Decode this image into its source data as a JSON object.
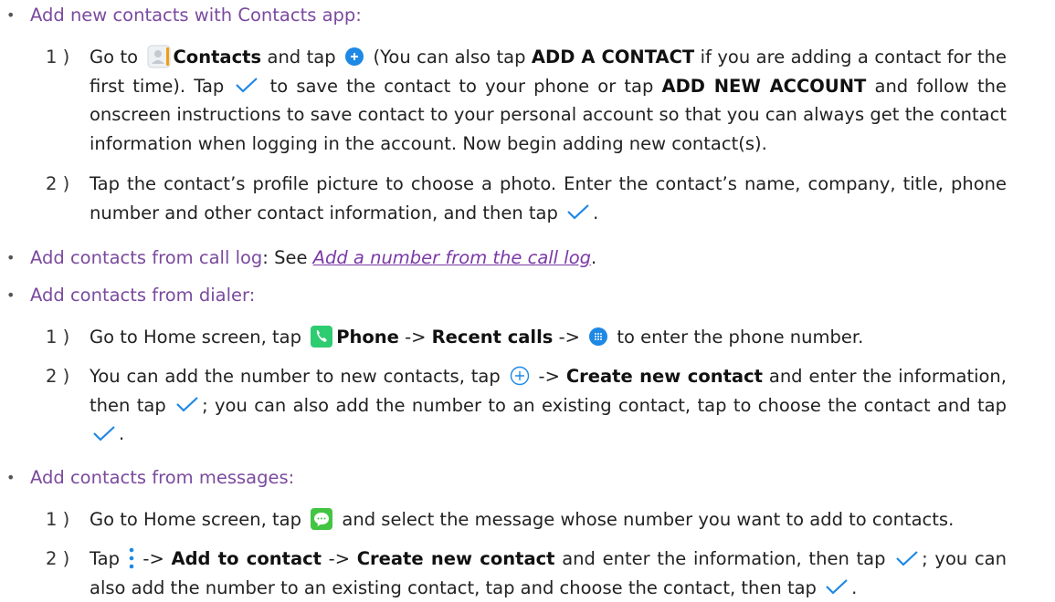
{
  "colors": {
    "heading": "#7b4a9e",
    "link": "#7b3aa6",
    "check": "#1e88e5",
    "contacts_dot": "#1e88e5",
    "phone_green": "#2ecc71",
    "messages_green": "#43c443"
  },
  "bullet_glyph": "•",
  "s1": {
    "heading": "Add new contacts with Contacts app:",
    "items": [
      {
        "num": "1 )",
        "a": "Go to ",
        "b_contacts": "Contacts",
        "c": " and tap ",
        "d": " (You can also tap ",
        "e_add_a_contact": "ADD A CONTACT",
        "f": " if you are adding a contact for the first time). Tap ",
        "g": " to save the contact to your phone or tap ",
        "h_add_new_account": "ADD NEW ACCOUNT",
        "i": " and follow the onscreen instructions to save contact to your personal account so that you can always get the contact information when logging in the account. Now begin adding new contact(s)."
      },
      {
        "num": "2 )",
        "a": "Tap the contact’s profile picture to choose a photo. Enter the contact’s name, company, title, phone number and other contact information, and then tap ",
        "b": "."
      }
    ]
  },
  "s2": {
    "heading": "Add contacts from call log",
    "rest_prefix": ": See ",
    "link_text": "Add a number from the call log",
    "rest_suffix": "."
  },
  "s3": {
    "heading": "Add contacts from dialer:",
    "items": [
      {
        "num": "1 )",
        "a": "Go to Home screen, tap ",
        "b_phone": "Phone",
        "c": " -> ",
        "d_recent_calls": "Recent calls",
        "e": " -> ",
        "f": " to enter the phone number."
      },
      {
        "num": "2 )",
        "a": "You can add the number to new contacts, tap ",
        "b": " -> ",
        "c_create_new_contact": "Create new contact",
        "d": " and enter the information, then tap ",
        "e": "; you can also add the number to an existing contact, tap to choose the contact and tap ",
        "f": "."
      }
    ]
  },
  "s4": {
    "heading": "Add contacts from messages:",
    "items": [
      {
        "num": "1 )",
        "a": "Go to Home screen, tap ",
        "b": " and select the message whose number you want to add to contacts."
      },
      {
        "num": "2 )",
        "a": "Tap ",
        "b": " -> ",
        "c_add_to_contact": "Add to contact",
        "d": " -> ",
        "e_create_new_contact": "Create new contact",
        "f": " and enter the information, then tap ",
        "g": "; you can also add the number to an existing contact, tap and choose the contact, then tap ",
        "h": "."
      }
    ]
  }
}
